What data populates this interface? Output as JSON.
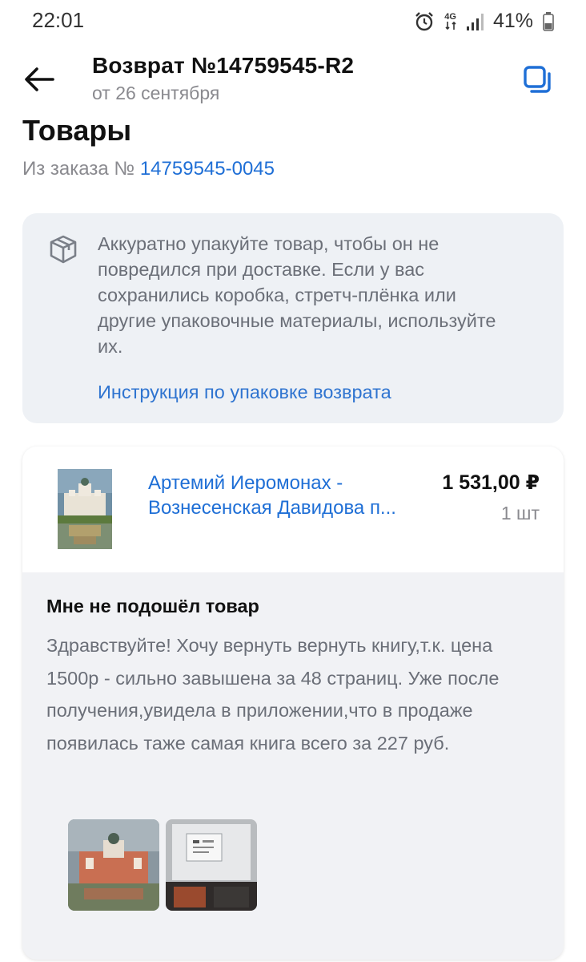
{
  "status_bar": {
    "time": "22:01",
    "network": "4G",
    "battery": "41%",
    "icons": [
      "alarm-icon",
      "network-4g-icon",
      "signal-icon",
      "battery-icon"
    ]
  },
  "header": {
    "title": "Возврат №14759545-R2",
    "subtitle": "от 26 сентября",
    "back_icon": "arrow-left-icon",
    "copy_icon": "copy-icon"
  },
  "section": {
    "title": "Товары",
    "order_prefix": "Из заказа №",
    "order_number": "14759545-0045"
  },
  "info": {
    "icon": "box-icon",
    "text": "Аккуратно упакуйте товар, чтобы он не повредился при доставке. Если у вас сохранились коробка, стретч-плёнка или другие упаковочные материалы, используйте их.",
    "link": "Инструкция по упаковке возврата"
  },
  "product": {
    "name_line1": "Артемий Иеромонах -",
    "name_line2": "Вознесенская Давидова п...",
    "price": "1 531,00 ₽",
    "quantity": "1 шт",
    "reason_title": "Мне не подошёл товар",
    "reason_text": "Здравствуйте! Хочу вернуть вернуть книгу,т.к. цена 1500р -  сильно завышена за 48 страниц. Уже после получения,увидела в приложении,что в продаже появилась таже самая книга всего за 227 руб."
  },
  "colors": {
    "accent": "#1f6fd6",
    "muted_text": "#8a8a8f",
    "info_bg": "#eef1f5"
  }
}
